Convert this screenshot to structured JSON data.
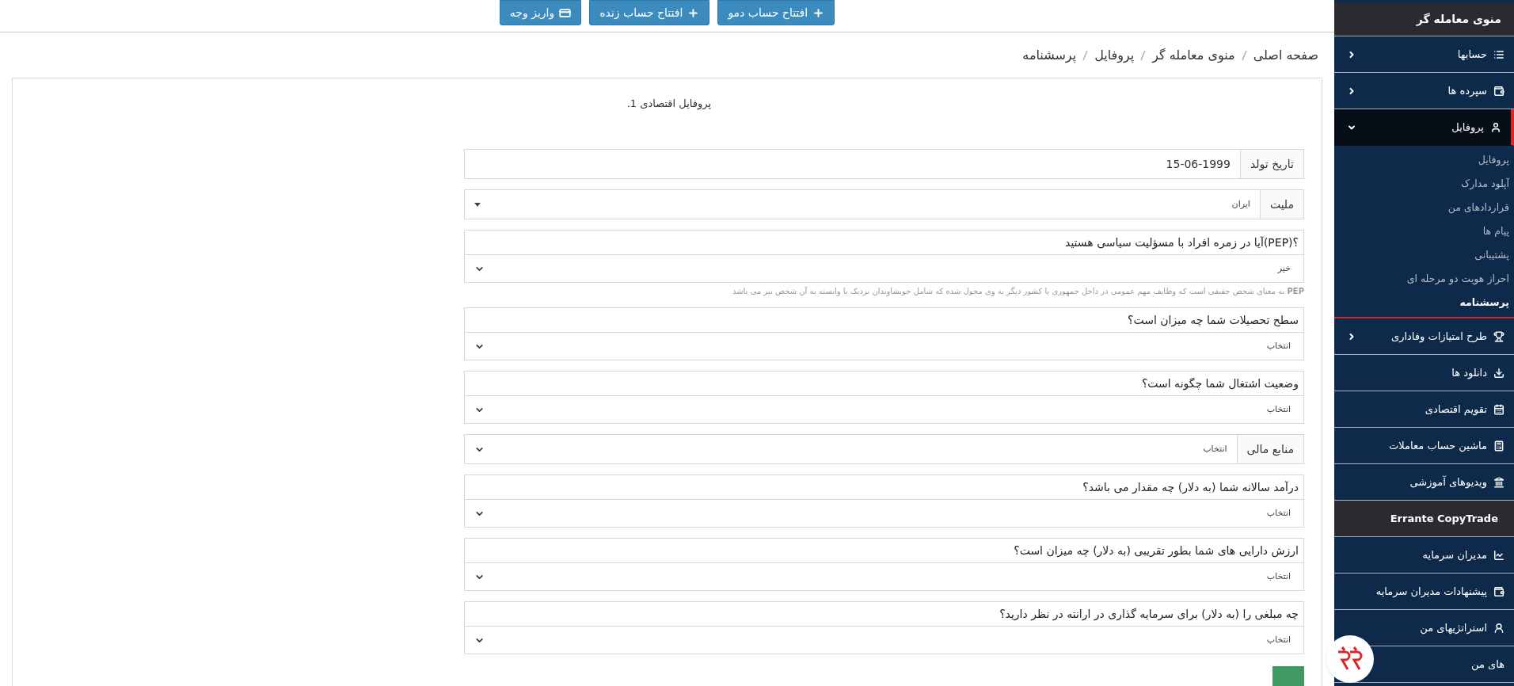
{
  "top_buttons": [
    {
      "label": "افتتاح حساب دمو",
      "kind": "plus"
    },
    {
      "label": "افتتاح حساب زنده",
      "kind": "plus"
    },
    {
      "label": "واریز وجه",
      "kind": "card"
    }
  ],
  "breadcrumb": [
    "صفحه اصلی",
    "منوی معامله گر",
    "پروفایل",
    "پرسشنامه"
  ],
  "form": {
    "title": "پروفایل اقتصادی 1.",
    "fields": [
      {
        "kind": "date",
        "label": "تاریخ تولد",
        "value": "15-06-1999"
      },
      {
        "kind": "dropdown",
        "label": "ملیت",
        "value": "ایران"
      },
      {
        "kind": "question",
        "label": "؟(PEP)آیا در زمره افراد با مسؤلیت سیاسی هستید",
        "value": "خیر"
      },
      {
        "kind": "note",
        "text": "**PEP** به معنای شخص حقیقی است که وظایف مهم عمومی در داخل جمهوری یا کشور دیگر به وی محول شده که شامل خویشاوندان نزدیک یا وابسته به آن شخص نیز می باشد"
      },
      {
        "kind": "question",
        "label": "سطح تحصیلات شما چه میزان است؟",
        "value": "انتخاب"
      },
      {
        "kind": "question",
        "label": "وضعیت اشتغال شما چگونه است؟",
        "value": "انتخاب"
      },
      {
        "kind": "select",
        "label": "منابع مالی",
        "value": "انتخاب"
      },
      {
        "kind": "question",
        "label": "درآمد سالانه شما (به دلار) چه مقدار می باشد؟",
        "value": "انتخاب"
      },
      {
        "kind": "question",
        "label": "ارزش دارایی های شما بطور تقریبی (به دلار) چه میزان است؟",
        "value": "انتخاب"
      },
      {
        "kind": "question",
        "label": "چه مبلغی را (به دلار) برای سرمایه گذاری در ارانته در نظر دارید؟",
        "value": "انتخاب"
      }
    ]
  },
  "sidebar": {
    "header": "منوی معامله گر",
    "items": [
      {
        "kind": "group",
        "label": "حسابها",
        "expanded": false
      },
      {
        "kind": "group",
        "label": "سپرده ها",
        "expanded": false
      },
      {
        "kind": "group",
        "label": "پروفایل",
        "expanded": true,
        "children": [
          {
            "label": "پروفایل",
            "selected": false
          },
          {
            "label": "آپلود مدارک",
            "selected": false
          },
          {
            "label": "قراردادهای من",
            "selected": false
          },
          {
            "label": "پیام ها",
            "selected": false
          },
          {
            "label": "پشتیبانی",
            "selected": false
          },
          {
            "label": "احراز هویت دو مرحله ای",
            "selected": false
          },
          {
            "label": "پرسشنامه",
            "selected": true
          }
        ]
      },
      {
        "kind": "group",
        "label": "طرح امتیازات وفاداری",
        "expanded": false
      },
      {
        "kind": "link",
        "label": "دانلود ها"
      },
      {
        "kind": "link",
        "label": "تقویم اقتصادی"
      },
      {
        "kind": "link",
        "label": "ماشین حساب معاملات"
      },
      {
        "kind": "link",
        "label": "ویدیوهای آموزشی"
      },
      {
        "kind": "section",
        "label": "Errante CopyTrade"
      },
      {
        "kind": "link",
        "label": "مدیران سرمایه"
      },
      {
        "kind": "link",
        "label": "پیشنهادات مدیران سرمایه"
      },
      {
        "kind": "link",
        "label": "استراتژیهای من"
      },
      {
        "kind": "link",
        "label": "های من"
      }
    ]
  }
}
